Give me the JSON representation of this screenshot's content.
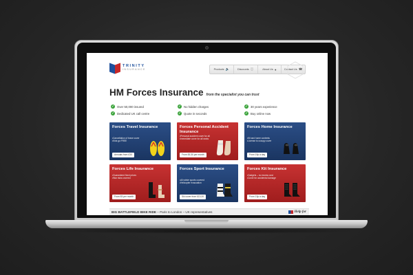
{
  "site": {
    "logo_name": "TRINITY",
    "logo_sub": "INSURANCE"
  },
  "nav": {
    "items": [
      {
        "label": "Products",
        "icon": "speaker-icon"
      },
      {
        "label": "Discounts",
        "icon": "info-icon"
      },
      {
        "label": "About Us",
        "icon": "user-icon"
      },
      {
        "label": "Contact Us",
        "icon": "phone-icon"
      }
    ]
  },
  "hero": {
    "title": "HM Forces Insurance",
    "tagline": "from the specialist you can trust"
  },
  "features": [
    "Over 50,000 insured",
    "No hidden charges",
    "30 years experience",
    "Dedicated UK call centre",
    "Quote in seconds",
    "Buy online now"
  ],
  "cards": [
    {
      "title": "Forces Travel Insurance",
      "bullets": [
        "Cancellation of leave cover",
        "Kids go FREE"
      ],
      "button": "Annuals from £33",
      "color": "#2b4e86"
    },
    {
      "title": "Forces Personal Accident Insurance",
      "bullets": [
        "Personal accident cover for all",
        "Immediate cover for all ranks"
      ],
      "button": "From £5.30 per month",
      "color": "#c73232"
    },
    {
      "title": "Forces Home Insurance",
      "bullets": [
        "Kit and home contents",
        "License to occupy cover"
      ],
      "button": "From 19p a day",
      "color": "#2b4e86"
    },
    {
      "title": "Forces Life Insurance",
      "bullets": [
        "Guaranteed fixed prices",
        "War risks covered"
      ],
      "button": "From £5 per month",
      "color": "#c73232"
    },
    {
      "title": "Forces Sport Insurance",
      "bullets": [
        "All winter sports covered",
        "Helicopter evacuation"
      ],
      "button": "Ski cover from £13.20",
      "color": "#2b4e86"
    },
    {
      "title": "Forces Kit Insurance",
      "bullets": [
        "Gadgets – no excess cost",
        "Cover for accidental damage"
      ],
      "button": "From 13p a day",
      "color": "#c73232"
    }
  ],
  "banner": {
    "text": "BIG BATTLEFIELD BIKE RIDE",
    "subtext": "– Paris to London – UK representatives",
    "logo_text": "Help for"
  },
  "colors": {
    "brand_blue": "#1d4f9c",
    "brand_red": "#c62828",
    "check_green": "#3aa33a"
  }
}
